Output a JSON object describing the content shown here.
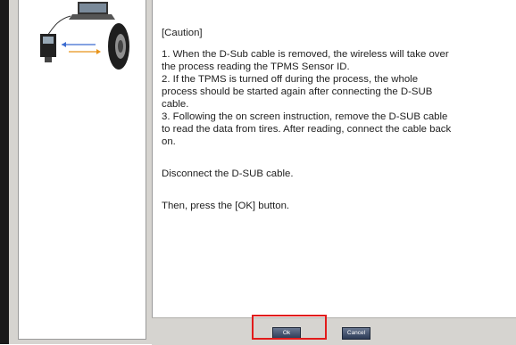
{
  "content": {
    "caution_title": "[Caution]",
    "lines": [
      "1. When the D-Sub cable is removed, the wireless will take over",
      "the process reading the TPMS Sensor ID.",
      "2. If the TPMS is turned off during the process, the whole",
      "process should be started again after connecting the D-SUB",
      "cable.",
      "3. Following the on screen instruction, remove the D-SUB cable",
      "to read the data from tires. After reading, connect the cable back",
      "on."
    ],
    "disconnect": "Disconnect the D-SUB cable.",
    "press": "Then, press the [OK] button."
  },
  "buttons": {
    "ok": "Ok",
    "cancel": "Cancel"
  },
  "colors": {
    "highlight": "#e21b1b",
    "button": "#2b3a56"
  },
  "icons": {
    "illustration": "laptop-scanner-tire-illustration"
  }
}
